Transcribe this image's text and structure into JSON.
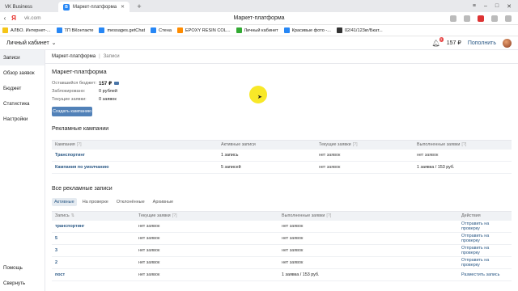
{
  "browser": {
    "tabs": [
      {
        "title": "VK Business",
        "active": false
      },
      {
        "title": "Маркет-платформа",
        "active": true
      }
    ],
    "url": "vk.com",
    "page_heading": "Маркет-платформа",
    "bookmarks": [
      {
        "label": "АЛБО. Интернет-...",
        "icon": "yandex-icon"
      },
      {
        "label": "ТП ВКонтакте",
        "icon": "vk-icon"
      },
      {
        "label": "messages.getChat",
        "icon": "vk-icon"
      },
      {
        "label": "Стена",
        "icon": "vk-icon"
      },
      {
        "label": "EPOXY RESIN COL...",
        "icon": "orange-icon"
      },
      {
        "label": "Личный кабинет",
        "icon": "green-icon"
      },
      {
        "label": "Красивые фото -...",
        "icon": "vk-icon"
      },
      {
        "label": "02/41/123кг/Бкат...",
        "icon": "dark-icon"
      }
    ]
  },
  "header": {
    "cabinet_label": "Личный кабинет",
    "notifications_count": "3",
    "balance": "157 ₽",
    "topup_label": "Пополнить"
  },
  "sidebar": {
    "items": [
      {
        "label": "Записи",
        "active": true
      },
      {
        "label": "Обзор заявок",
        "active": false
      },
      {
        "label": "Бюджет",
        "active": false
      },
      {
        "label": "Статистика",
        "active": false
      },
      {
        "label": "Настройки",
        "active": false
      }
    ],
    "bottom": [
      {
        "label": "Помощь"
      },
      {
        "label": "Свернуть"
      }
    ]
  },
  "main": {
    "breadcrumb": {
      "root": "Маркет-платформа",
      "current": "Записи"
    },
    "title": "Маркет-платформа",
    "stats": [
      {
        "label": "Оставшийся бюджет:",
        "value": "157 ₽"
      },
      {
        "label": "Заблокировано:",
        "value": "0 рублей"
      },
      {
        "label": "Текущие заявки:",
        "value": "0 заявок"
      }
    ],
    "create_button": "Создать кампанию",
    "campaigns": {
      "title": "Рекламные кампании",
      "columns": [
        "Кампания",
        "Активные записи",
        "Текущие заявки",
        "Выполненные заявки"
      ],
      "rows": [
        [
          "Транспортинг",
          "1 запись",
          "нет заявок",
          "нет заявок"
        ],
        [
          "Кампания по умолчанию",
          "5 записей",
          "нет заявок",
          "1 заявка / 153 руб."
        ]
      ]
    },
    "records": {
      "title": "Все рекламные записи",
      "filters": [
        "Активные",
        "На проверке",
        "Отклонённые",
        "Архивные"
      ],
      "columns": [
        "Запись",
        "Текущие заявки",
        "Выполненные заявки",
        "Действия"
      ],
      "rows": [
        [
          "транспортинг",
          "нет заявок",
          "нет заявок",
          "Отправить на проверку"
        ],
        [
          "5",
          "нет заявок",
          "нет заявок",
          "Отправить на проверку"
        ],
        [
          "3",
          "нет заявок",
          "нет заявок",
          "Отправить на проверку"
        ],
        [
          "2",
          "нет заявок",
          "нет заявок",
          "Отправить на проверку"
        ],
        [
          "пост",
          "нет заявок",
          "1 заявка / 153 руб.",
          "Разместить запись"
        ]
      ]
    }
  },
  "colors": {
    "accent": "#5181b8",
    "link": "#2a5885",
    "header_bg": "#f0f2f5"
  }
}
